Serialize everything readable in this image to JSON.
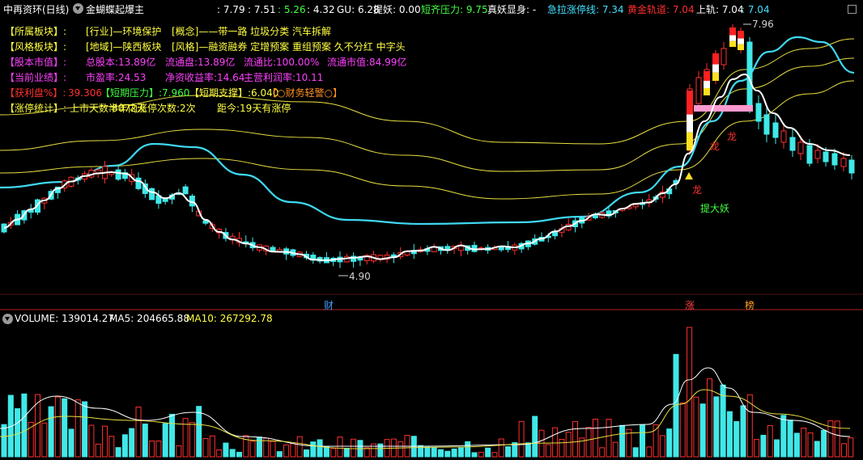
{
  "header": {
    "stock_title": "中再资环(日线)",
    "indicator_name": "金蝴蝶起爆主",
    "indicator_values": [
      {
        "text": ": 7.79",
        "color": "#ffffff"
      },
      {
        "text": ": 7.51",
        "color": "#ffffff"
      },
      {
        "text": ": 5.26",
        "color": "#40ff40"
      },
      {
        "text": ": 4.32",
        "color": "#ffffff"
      },
      {
        "text": "GU: 6.28",
        "color": "#ffffff"
      },
      {
        "text": "提妖: 0.00",
        "color": "#ffffff"
      },
      {
        "text": "短齐压力: 9.75",
        "color": "#40ff40"
      },
      {
        "text": "真妖显身: -",
        "color": "#ffffff"
      },
      {
        "text": "急拉涨停线: 7.34",
        "color": "#40e0ff"
      },
      {
        "text": "黄金轨道: 7.04",
        "color": "#ff3030"
      },
      {
        "text": "上轨: 7.04",
        "color": "#ffffff"
      },
      {
        "text": ": 7.04",
        "color": "#40e0ff"
      }
    ]
  },
  "info_rows": [
    {
      "label": "【所属板块】:",
      "label_color": "#ffff40",
      "parts": [
        {
          "text": "[行业]—环境保护",
          "color": "#ffff40"
        },
        {
          "text": "[概念]——带一路 垃圾分类 汽车拆解",
          "color": "#ffff40"
        }
      ]
    },
    {
      "label": "【风格板块】:",
      "label_color": "#ffff40",
      "parts": [
        {
          "text": "[地域]—陕西板块",
          "color": "#ffff40"
        },
        {
          "text": "[风格]—融资融券 定增预案 重组预案 久不分红 中字头",
          "color": "#ffff40"
        }
      ]
    },
    {
      "label": "【股本市值】:",
      "label_color": "#ff40ff",
      "parts": [
        {
          "text": "总股本:13.89亿",
          "color": "#ff40ff"
        },
        {
          "text": "流通盘:13.89亿",
          "color": "#ff40ff"
        },
        {
          "text": "流通比:100.00%",
          "color": "#ff40ff"
        },
        {
          "text": "流通市值:84.99亿",
          "color": "#ff40ff"
        }
      ]
    },
    {
      "label": "【当前业绩】:",
      "label_color": "#ff40ff",
      "parts": [
        {
          "text": "市盈率:24.53",
          "color": "#ff40ff"
        },
        {
          "text": "净资收益率:14.64",
          "color": "#ff40ff"
        },
        {
          "text": "主营利润率:10.11",
          "color": "#ff40ff"
        }
      ]
    },
    {
      "label": "【获利盘%】:",
      "label_color": "#ff3030",
      "parts": [
        {
          "text": "39.306",
          "color": "#ff3030"
        },
        {
          "text": "【短期压力】:7.960",
          "color": "#40ff40"
        },
        {
          "text": "【短期支撑】:6.040",
          "color": "#ffff40"
        },
        {
          "text": "【○财务轻警○】",
          "color": "#ff9020"
        }
      ]
    },
    {
      "label": "【涨停统计】:",
      "label_color": "#ffff40",
      "parts": [
        {
          "text": "上市天数:8072天",
          "color": "#ffff40"
        },
        {
          "text": "半年内涨停次数:2次",
          "color": "#ffff40"
        },
        {
          "text": "距今:19天有涨停",
          "color": "#ffff40"
        }
      ]
    }
  ],
  "annotations": {
    "high": "7.96",
    "low": "4.90",
    "dragon": "龙",
    "tiyao": "提大妖",
    "cai": "财",
    "zhang": "涨",
    "bang": "榜"
  },
  "volume": {
    "label": "VOLUME: 139014.27",
    "ma5": "MA5: 204665.88",
    "ma10": "MA10: 267292.78"
  },
  "colors": {
    "up": "#ff3030",
    "down": "#40e8e8",
    "ma_white": "#ffffff",
    "ma_cyan": "#3fd8f0",
    "band": "#e8e040"
  }
}
